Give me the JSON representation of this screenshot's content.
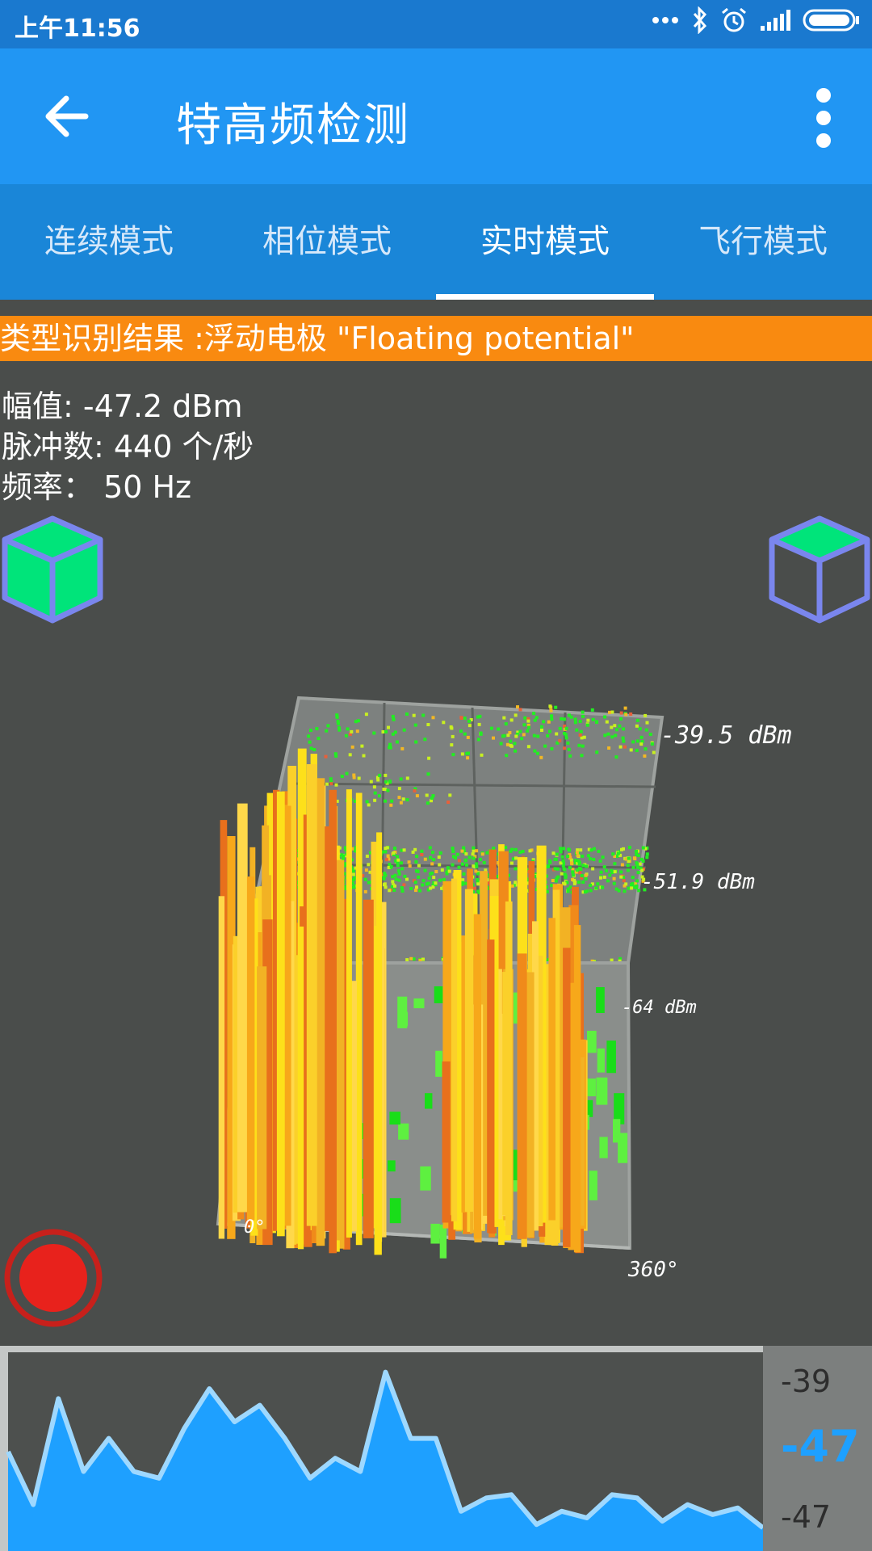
{
  "status_bar": {
    "time": "上午11:56",
    "icons": [
      "more-dots-icon",
      "bluetooth-icon",
      "alarm-icon",
      "signal-icon",
      "battery-icon"
    ]
  },
  "app_bar": {
    "title": "特高频检测",
    "back_icon": "arrow-left-icon",
    "menu_icon": "more-vert-icon",
    "color": "#2196f3"
  },
  "tabs": [
    {
      "label": "连续模式",
      "active": false
    },
    {
      "label": "相位模式",
      "active": false
    },
    {
      "label": "实时模式",
      "active": true
    },
    {
      "label": "飞行模式",
      "active": false
    }
  ],
  "result": {
    "banner": "类型识别结果 :浮动电极 \"Floating potential\"",
    "color": "#f98a10"
  },
  "measurements": {
    "amplitude": "幅值: -47.2 dBm",
    "pulses": "脉冲数: 440 个/秒",
    "frequency": "频率：  50 Hz"
  },
  "view_controls": {
    "left_icon": "solid-cube-icon",
    "right_icon": "wireframe-cube-icon"
  },
  "chart_data": {
    "type": "bar",
    "z_axis_labels": [
      "-39.5 dBm",
      "-51.9 dBm",
      "-64 dBm"
    ],
    "phase_axis_labels": [
      "0°",
      "360°"
    ],
    "colors": {
      "high": "#f7931e",
      "mid": "#fde01a",
      "low": "#22dd22"
    }
  },
  "record": {
    "icon": "record-icon",
    "color": "#e8221c"
  },
  "trend": {
    "max_label": "-39",
    "current_value": "-47",
    "min_label": "-47",
    "values": [
      -44.0,
      -45.6,
      -42.4,
      -44.6,
      -43.6,
      -44.6,
      -44.8,
      -43.3,
      -42.1,
      -43.1,
      -42.6,
      -43.6,
      -44.8,
      -44.2,
      -44.6,
      -41.6,
      -43.6,
      -43.6,
      -45.8,
      -45.4,
      -45.3,
      -46.2,
      -45.8,
      -46.0,
      -45.3,
      -45.4,
      -46.1,
      -45.6,
      -45.9,
      -45.7,
      -46.3
    ],
    "ylim": [
      -47,
      -41
    ],
    "fill_color": "#1ea0ff",
    "line_color": "#9ed8ff"
  }
}
